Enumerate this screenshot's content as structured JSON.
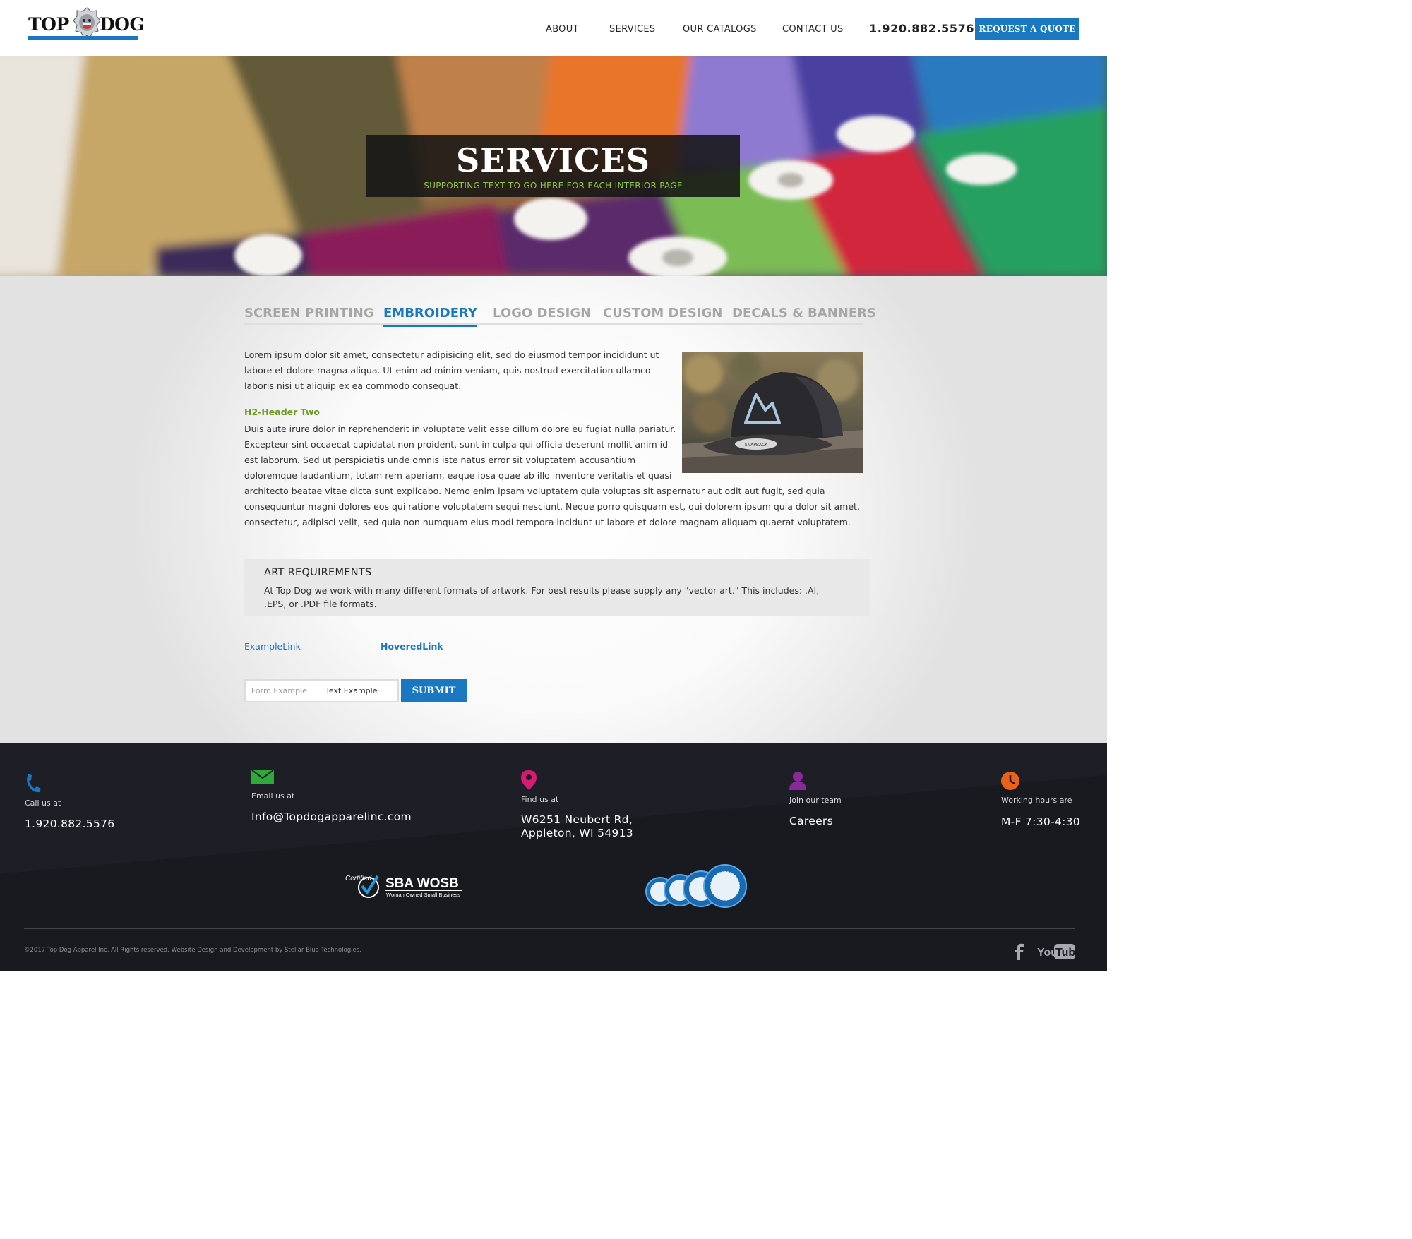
{
  "header": {
    "logo_top": "TOP",
    "logo_dog": "DOG",
    "nav": [
      "ABOUT",
      "SERVICES",
      "OUR CATALOGS",
      "CONTACT US"
    ],
    "phone": "1.920.882.5576",
    "quote_button": "REQUEST A QUOTE"
  },
  "hero": {
    "title": "SERVICES",
    "subtitle": "SUPPORTING TEXT TO GO HERE FOR EACH INTERIOR PAGE"
  },
  "tabs": [
    {
      "label": "SCREEN PRINTING",
      "active": false
    },
    {
      "label": "EMBROIDERY",
      "active": true
    },
    {
      "label": "LOGO DESIGN",
      "active": false
    },
    {
      "label": "CUSTOM DESIGN",
      "active": false
    },
    {
      "label": "DECALS & BANNERS",
      "active": false
    }
  ],
  "content": {
    "intro_lines": [
      "Lorem ipsum dolor sit amet, consectetur adipisicing elit, sed do eiusmod tempor incididunt ut",
      "labore et dolore magna aliqua. Ut enim ad minim veniam, quis nostrud exercitation ullamco",
      "laboris nisi ut aliquip ex ea commodo consequat."
    ],
    "h2": "H2-Header Two",
    "body_lines": [
      "Duis aute irure dolor in reprehenderit in voluptate velit esse cillum dolore eu fugiat nulla pariatur.",
      "Excepteur sint occaecat cupidatat non proident, sunt in culpa qui officia deserunt mollit anim id",
      "est laborum. Sed ut perspiciatis unde omnis iste natus error sit voluptatem accusantium",
      "doloremque laudantium, totam rem aperiam, eaque ipsa quae ab illo inventore veritatis et quasi",
      "architecto beatae vitae dicta sunt explicabo. Nemo enim ipsam voluptatem quia voluptas sit aspernatur aut odit aut fugit, sed quia",
      "consequuntur magni dolores eos qui ratione voluptatem sequi nesciunt. Neque porro quisquam est, qui dolorem ipsum quia dolor sit amet,",
      "consectetur, adipisci velit, sed quia non numquam eius modi tempora incidunt ut labore et dolore magnam aliquam quaerat voluptatem."
    ],
    "cap_label": "SNAPBACK"
  },
  "art_requirements": {
    "title": "ART REQUIREMENTS",
    "text": "At Top Dog we work with many different formats of artwork. For best results please supply any \"vector art.\" This includes: .AI, .EPS, or .PDF file formats."
  },
  "links": {
    "example": "ExampleLink",
    "hovered": "HoveredLink"
  },
  "form": {
    "placeholder": "Form Example",
    "value": "Text Example",
    "submit": "SUBMIT"
  },
  "footer": {
    "call_label": "Call us at",
    "call_value": "1.920.882.5576",
    "email_label": "Email us at",
    "email_value": "Info@Topdogapparelinc.com",
    "find_label": "Find us at",
    "find_line1": "W6251 Neubert Rd,",
    "find_line2": "Appleton, WI 54913",
    "team_label": "Join our team",
    "team_value": "Careers",
    "hours_label": "Working hours are",
    "hours_value": "M-F  7:30-4:30",
    "sba_certified": "Certified",
    "sba_name": "SBA WOSB",
    "sba_sub": "Woman Owned Small Business",
    "copyright": "©2017 Top Dog Apparel Inc. All Rights reserved. Website Design and Development by Stellar Blue Technologies.",
    "social": [
      "facebook-icon",
      "youtube-icon"
    ],
    "youtube_label": "YouTube"
  },
  "colors": {
    "brand_blue": "#1a78c2",
    "accent_green": "#8cc63f",
    "footer_bg": "#1b1b22"
  }
}
